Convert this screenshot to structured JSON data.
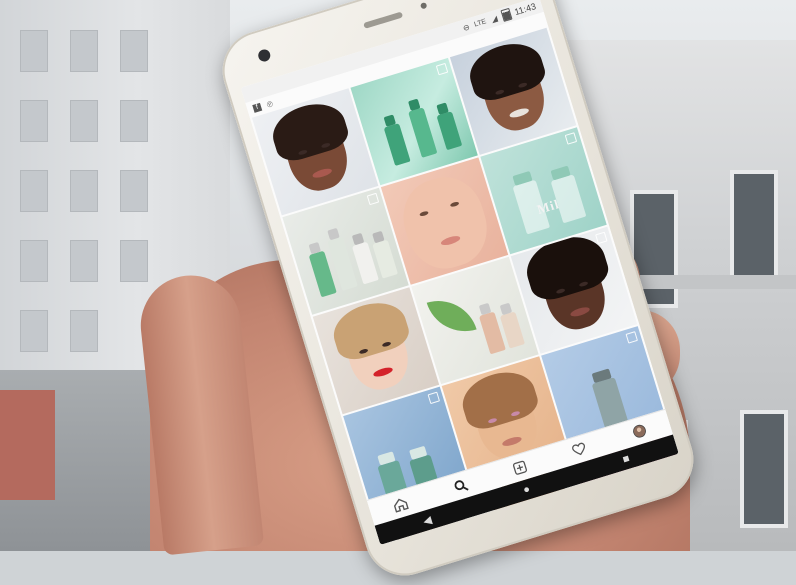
{
  "status_bar": {
    "time": "11:43",
    "network": "LTE",
    "icons": [
      "dnd-icon",
      "signal-icon",
      "battery-icon"
    ]
  },
  "app_bar": {
    "icons": [
      "facebook-icon",
      "pinterest-icon"
    ]
  },
  "product_logo": "Mil",
  "bottom_nav": {
    "items": [
      "home-icon",
      "search-icon",
      "add-post-icon",
      "heart-icon",
      "profile-icon"
    ]
  },
  "android_nav": [
    "back-icon",
    "home-circle-icon",
    "recents-icon"
  ],
  "colors": {
    "screen_bg": "#fbfbfb",
    "product_green": "#3fa37a",
    "lipstick_red": "#d4222a",
    "product_pink": "#e79aaa"
  }
}
